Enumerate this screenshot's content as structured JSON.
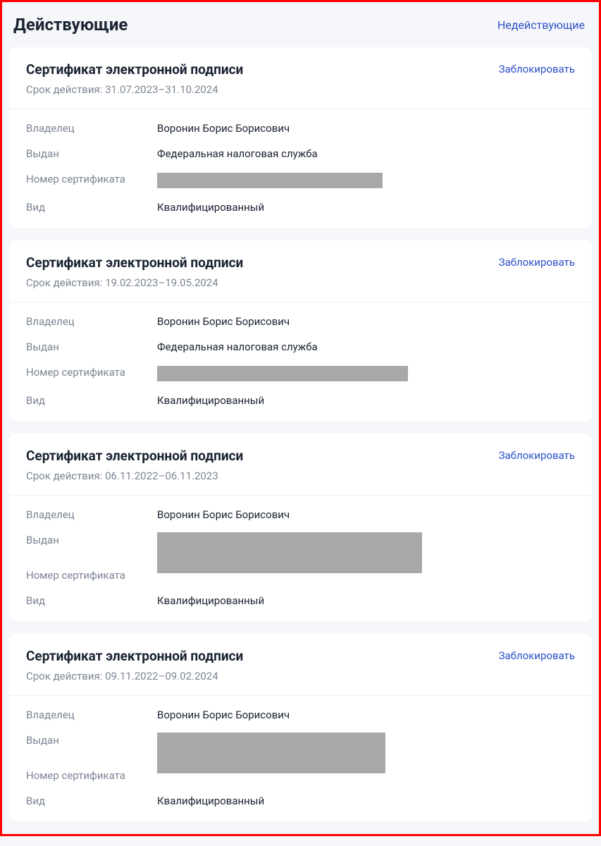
{
  "tabs": {
    "active_label": "Действующие",
    "inactive_label": "Недействующие"
  },
  "labels": {
    "card_title": "Сертификат электронной подписи",
    "validity_prefix": "Срок действия: ",
    "block_action": "Заблокировать",
    "owner": "Владелец",
    "issued_by": "Выдан",
    "cert_number": "Номер сертификата",
    "type": "Вид"
  },
  "certificates": [
    {
      "validity": "31.07.2023–31.10.2024",
      "owner": "Воронин Борис Борисович",
      "issued_by": "Федеральная налоговая служба",
      "cert_number_redacted": true,
      "type": "Квалифицированный"
    },
    {
      "validity": "19.02.2023–19.05.2024",
      "owner": "Воронин Борис Борисович",
      "issued_by": "Федеральная налоговая служба",
      "cert_number_redacted": true,
      "type": "Квалифицированный"
    },
    {
      "validity": "06.11.2022–06.11.2023",
      "owner": "Воронин Борис Борисович",
      "issued_by_redacted": true,
      "cert_number_redacted": true,
      "type": "Квалифицированный"
    },
    {
      "validity": "09.11.2022–09.02.2024",
      "owner": "Воронин Борис Борисович",
      "issued_by_redacted": true,
      "cert_number_redacted": true,
      "type": "Квалифицированный"
    }
  ]
}
